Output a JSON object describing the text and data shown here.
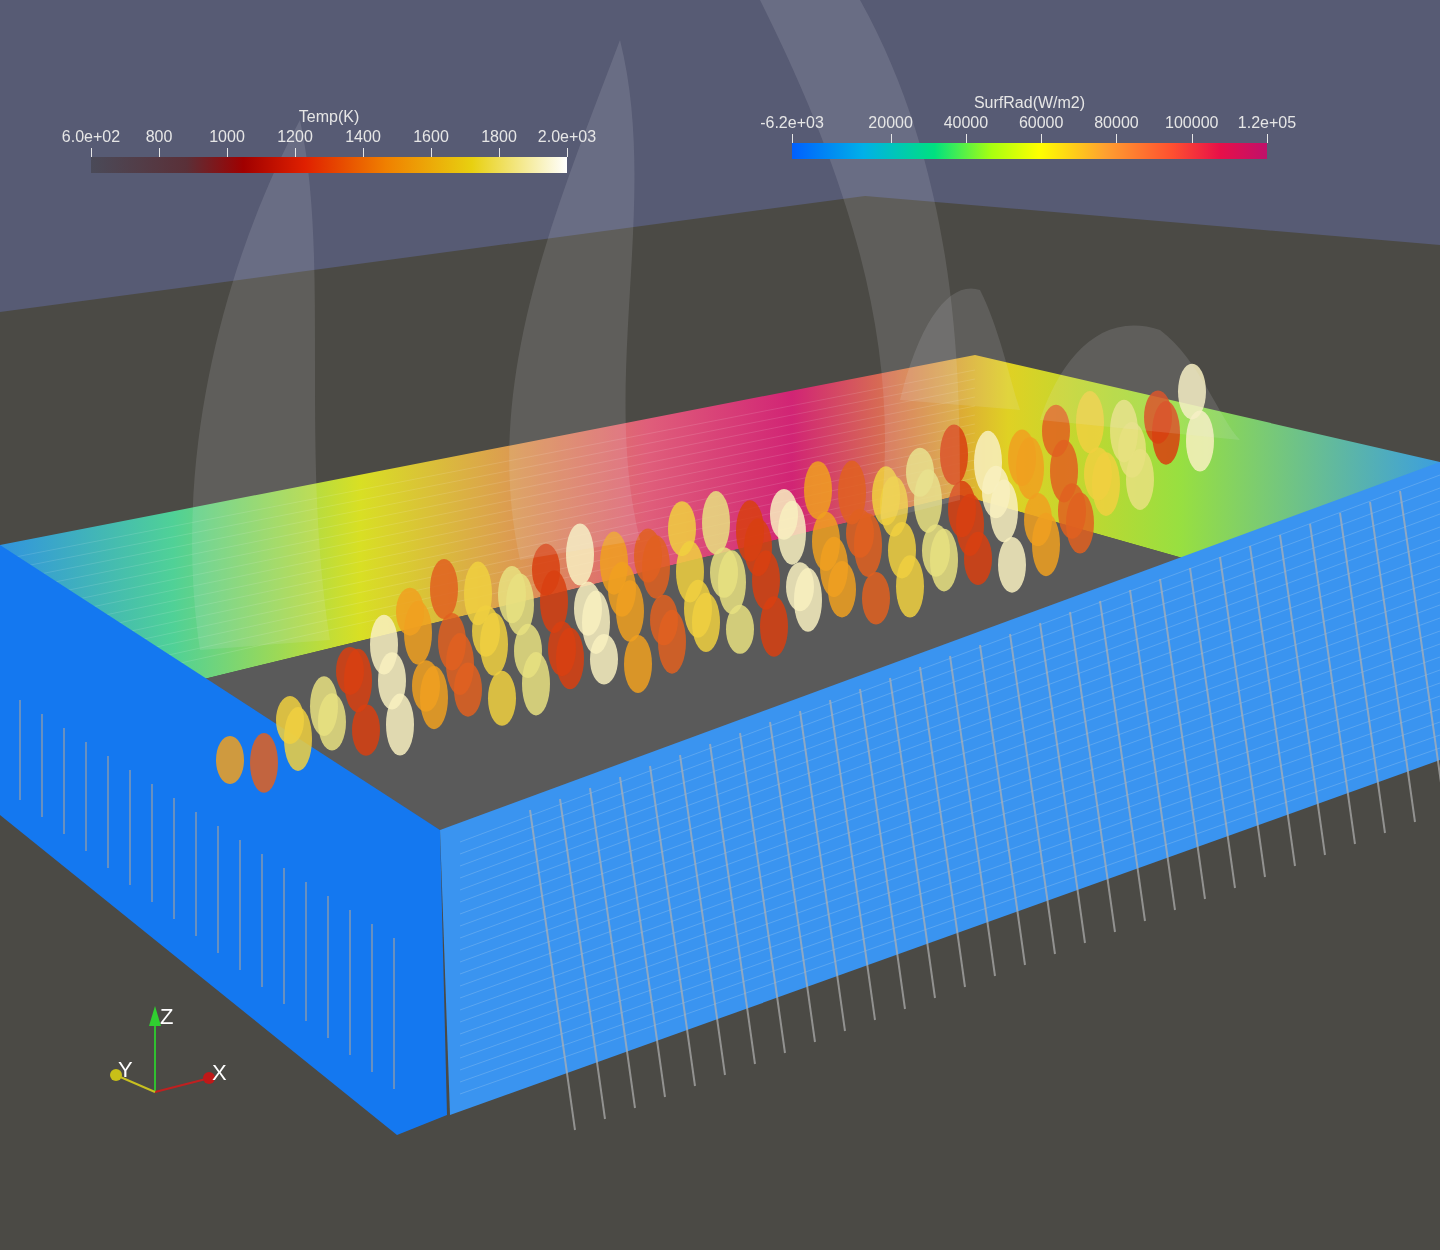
{
  "legends": [
    {
      "title": "Temp(K)",
      "kind": "blackbody",
      "ticks": [
        "6.0e+02",
        "800",
        "1000",
        "1200",
        "1400",
        "1600",
        "1800",
        "2.0e+03"
      ]
    },
    {
      "title": "SurfRad(W/m2)",
      "kind": "rainbow",
      "ticks": [
        "-6.2e+03",
        "20000",
        "40000",
        "60000",
        "80000",
        "100000",
        "1.2e+05"
      ]
    }
  ],
  "axes": {
    "z": "Z",
    "y": "Y",
    "x": "X"
  }
}
